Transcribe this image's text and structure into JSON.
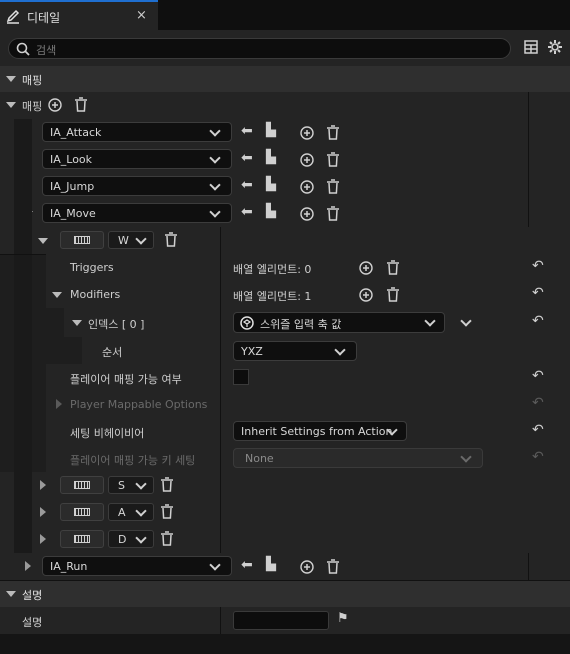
{
  "tab": {
    "title": "디테일",
    "close": "×"
  },
  "search": {
    "placeholder": "검색"
  },
  "section_mapping": {
    "title": "매핑"
  },
  "mapping_row": {
    "label": "매핑"
  },
  "actions": [
    {
      "name": "IA_Attack"
    },
    {
      "name": "IA_Look"
    },
    {
      "name": "IA_Jump"
    },
    {
      "name": "IA_Move"
    }
  ],
  "move_keys": [
    {
      "key": "W"
    },
    {
      "key": "S"
    },
    {
      "key": "A"
    },
    {
      "key": "D"
    }
  ],
  "triggers": {
    "label": "Triggers",
    "value": "배열 엘리먼트: 0"
  },
  "modifiers": {
    "label": "Modifiers",
    "value": "배열 엘리먼트: 1"
  },
  "index": {
    "label": "인덱스 [ 0 ]",
    "value": "스위즐 입력 축 값"
  },
  "order": {
    "label": "순서",
    "value": "YXZ"
  },
  "player_mappable": {
    "label": "플레이어 매핑 가능 여부"
  },
  "player_mappable_options": {
    "label": "Player Mappable Options"
  },
  "setting_behavior": {
    "label": "세팅 비헤이비어",
    "value": "Inherit Settings from Action"
  },
  "player_key_setting": {
    "label": "플레이어 매핑 가능 키 세팅",
    "value": "None"
  },
  "run_action": {
    "name": "IA_Run"
  },
  "section_description": {
    "title": "설명"
  },
  "description_row": {
    "label": "설명",
    "value": ""
  }
}
